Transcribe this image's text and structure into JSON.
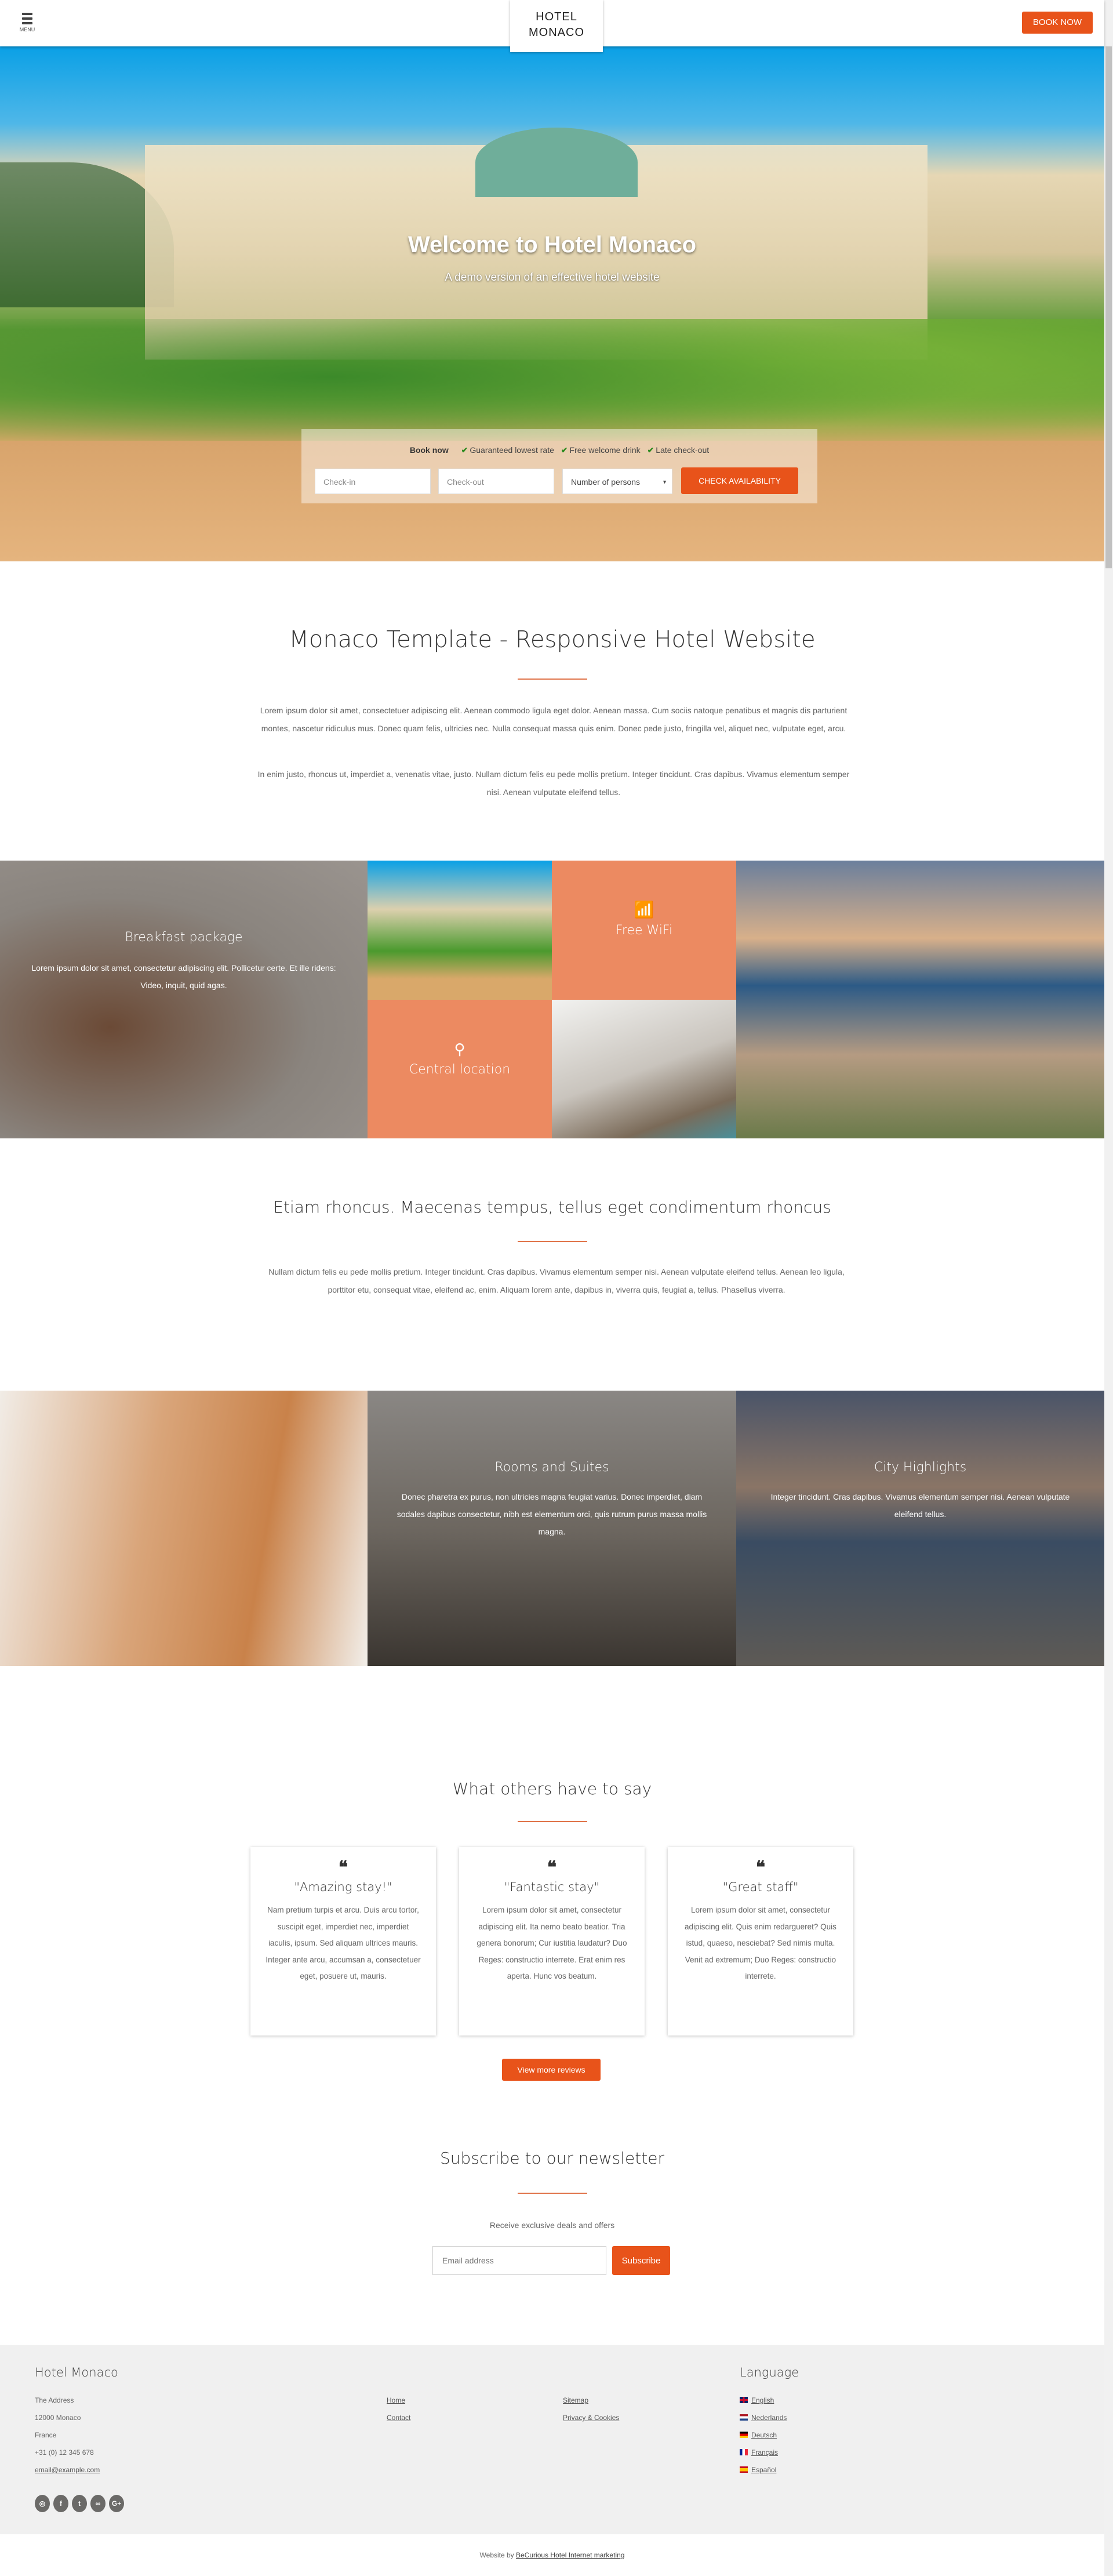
{
  "header": {
    "menu_label": "MENU",
    "logo_line1": "HOTEL",
    "logo_line2": "MONACO",
    "book_now": "BOOK NOW"
  },
  "hero": {
    "title": "Welcome to Hotel Monaco",
    "subtitle": "A demo version of an effective hotel website",
    "booking": {
      "label": "Book now",
      "perks": [
        "Guaranteed lowest rate",
        "Free welcome drink",
        "Late check-out"
      ],
      "checkin_placeholder": "Check-in",
      "checkout_placeholder": "Check-out",
      "persons_selected": "Number of persons",
      "submit": "CHECK AVAILABILITY"
    }
  },
  "intro": {
    "title": "Monaco Template - Responsive Hotel Website",
    "paragraphs": [
      "Lorem ipsum dolor sit amet, consectetuer adipiscing elit. Aenean commodo ligula eget dolor. Aenean massa. Cum sociis natoque penatibus et magnis dis parturient montes, nascetur ridiculus mus. Donec quam felis, ultricies nec. Nulla consequat massa quis enim. Donec pede justo, fringilla vel, aliquet nec, vulputate eget, arcu.",
      "In enim justo, rhoncus ut, imperdiet a, venenatis vitae, justo. Nullam dictum felis eu pede mollis pretium. Integer tincidunt. Cras dapibus. Vivamus elementum semper nisi. Aenean vulputate eleifend tellus."
    ]
  },
  "features": {
    "breakfast": {
      "title": "Breakfast package",
      "text": "Lorem ipsum dolor sit amet, consectetur adipiscing elit. Pollicetur certe. Et ille ridens: Video, inquit, quid agas."
    },
    "wifi": {
      "title": "Free WiFi",
      "icon": "wifi-icon"
    },
    "location": {
      "title": "Central location",
      "icon": "map-pin-icon"
    }
  },
  "section2": {
    "title": "Etiam rhoncus. Maecenas tempus, tellus eget condimentum rhoncus",
    "text": "Nullam dictum felis eu pede mollis pretium. Integer tincidunt. Cras dapibus. Vivamus elementum semper nisi. Aenean vulputate eleifend tellus. Aenean leo ligula, porttitor etu, consequat vitae, eleifend ac, enim. Aliquam lorem ante, dapibus in, viverra quis, feugiat a, tellus. Phasellus viverra."
  },
  "tiles": {
    "rooms": {
      "title": "Rooms and Suites",
      "text": "Donec pharetra ex purus, non ultricies magna feugiat varius. Donec imperdiet, diam sodales dapibus consectetur, nibh est elementum orci, quis rutrum purus massa mollis magna."
    },
    "city": {
      "title": "City Highlights",
      "text": "Integer tincidunt. Cras dapibus. Vivamus elementum semper nisi. Aenean vulputate eleifend tellus."
    }
  },
  "reviews": {
    "title": "What others have to say",
    "items": [
      {
        "title": "\"Amazing stay!\"",
        "text": "Nam pretium turpis et arcu. Duis arcu tortor, suscipit eget, imperdiet nec, imperdiet iaculis, ipsum. Sed aliquam ultrices mauris. Integer ante arcu, accumsan a, consectetuer eget, posuere ut, mauris."
      },
      {
        "title": "\"Fantastic stay\"",
        "text": "Lorem ipsum dolor sit amet, consectetur adipiscing elit. Ita nemo beato beatior. Tria genera bonorum; Cur iustitia laudatur? Duo Reges: constructio interrete. Erat enim res aperta. Hunc vos beatum."
      },
      {
        "title": "\"Great staff\"",
        "text": "Lorem ipsum dolor sit amet, consectetur adipiscing elit. Quis enim redargueret? Quis istud, quaeso, nesciebat? Sed nimis multa. Venit ad extremum; Duo Reges: constructio interrete."
      }
    ],
    "more": "View more reviews"
  },
  "newsletter": {
    "title": "Subscribe to our newsletter",
    "text": "Receive exclusive deals and offers",
    "email_placeholder": "Email address",
    "submit": "Subscribe"
  },
  "footer": {
    "title": "Hotel Monaco",
    "address": [
      "The Address",
      "12000 Monaco",
      "France",
      "+31 (0) 12 345 678"
    ],
    "email": "email@example.com",
    "links1": [
      "Home",
      "Contact"
    ],
    "links2": [
      "Sitemap",
      "Privacy & Cookies"
    ],
    "language_title": "Language",
    "languages": [
      "English",
      "Nederlands",
      "Deutsch",
      "Français",
      "Español"
    ],
    "social": [
      "instagram-icon",
      "facebook-icon",
      "twitter-icon",
      "tripadvisor-icon",
      "google-plus-icon"
    ],
    "credit_prefix": "Website by",
    "credit_link": "BeCurious Hotel Internet marketing"
  },
  "colors": {
    "accent": "#e8531a",
    "tile_orange": "#ec8a61",
    "footer_bg": "#f0f0f0"
  }
}
